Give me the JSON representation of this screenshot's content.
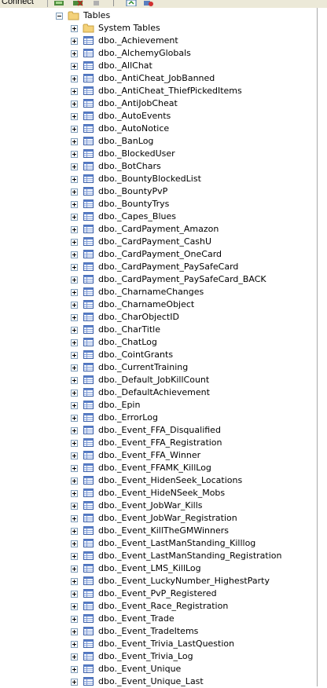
{
  "toolbar": {
    "connect_label": "Connect"
  },
  "tree": {
    "tables_label": "Tables",
    "system_tables_label": "System Tables",
    "items": [
      "dbo._Achievement",
      "dbo._AlchemyGlobals",
      "dbo._AllChat",
      "dbo._AntiCheat_JobBanned",
      "dbo._AntiCheat_ThiefPickedItems",
      "dbo._AntiJobCheat",
      "dbo._AutoEvents",
      "dbo._AutoNotice",
      "dbo._BanLog",
      "dbo._BlockedUser",
      "dbo._BotChars",
      "dbo._BountyBlockedList",
      "dbo._BountyPvP",
      "dbo._BountyTrys",
      "dbo._Capes_Blues",
      "dbo._CardPayment_Amazon",
      "dbo._CardPayment_CashU",
      "dbo._CardPayment_OneCard",
      "dbo._CardPayment_PaySafeCard",
      "dbo._CardPayment_PaySafeCard_BACK",
      "dbo._CharnameChanges",
      "dbo._CharnameObject",
      "dbo._CharObjectID",
      "dbo._CharTitle",
      "dbo._ChatLog",
      "dbo._CointGrants",
      "dbo._CurrentTraining",
      "dbo._Default_JobKillCount",
      "dbo._DefaultAchievement",
      "dbo._Epin",
      "dbo._ErrorLog",
      "dbo._Event_FFA_Disqualified",
      "dbo._Event_FFA_Registration",
      "dbo._Event_FFA_Winner",
      "dbo._Event_FFAMK_KillLog",
      "dbo._Event_HidenSeek_Locations",
      "dbo._Event_HideNSeek_Mobs",
      "dbo._Event_JobWar_Kills",
      "dbo._Event_JobWar_Registration",
      "dbo._Event_KillTheGMWinners",
      "dbo._Event_LastManStanding_Killlog",
      "dbo._Event_LastManStanding_Registration",
      "dbo._Event_LMS_KillLog",
      "dbo._Event_LuckyNumber_HighestParty",
      "dbo._Event_PvP_Registered",
      "dbo._Event_Race_Registration",
      "dbo._Event_Trade",
      "dbo._Event_TradeItems",
      "dbo._Event_Trivia_LastQuestion",
      "dbo._Event_Trivia_Log",
      "dbo._Event_Unique",
      "dbo._Event_Unique_Last"
    ]
  }
}
